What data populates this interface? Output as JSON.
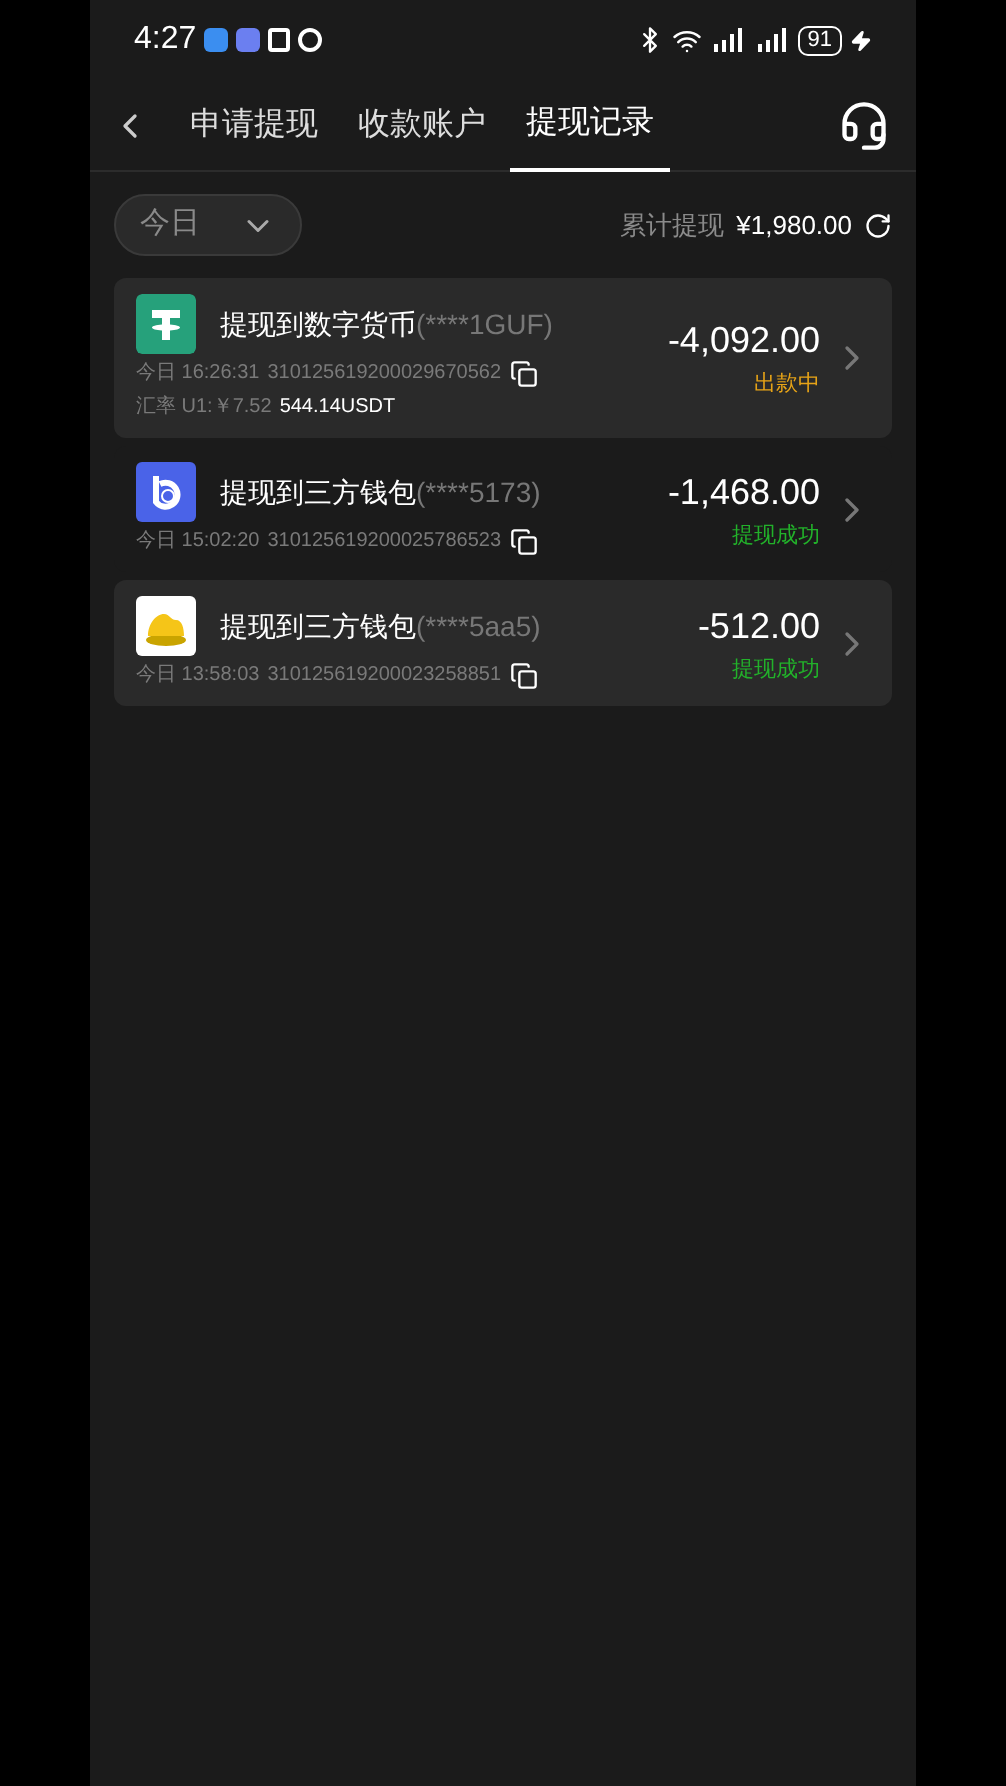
{
  "status_bar": {
    "time": "4:27",
    "battery": "91"
  },
  "tabs": [
    {
      "label": "申请提现",
      "selected": false
    },
    {
      "label": "收款账户",
      "selected": false
    },
    {
      "label": "提现记录",
      "selected": true
    }
  ],
  "filter": {
    "value": "今日"
  },
  "total": {
    "label": "累计提现",
    "amount": "¥1,980.00"
  },
  "records": [
    {
      "kind": "usdt",
      "title": "提现到数字货币",
      "account": "(****1GUF)",
      "time": "今日 16:26:31",
      "order": "310125619200029670562",
      "rate_label": "汇率 U1:￥7.52",
      "rate_value": "544.14USDT",
      "amount": "-4,092.00",
      "status": {
        "text": "出款中",
        "kind": "pending"
      },
      "selected": true
    },
    {
      "kind": "wallet_b",
      "title": "提现到三方钱包",
      "account": "(****5173)",
      "time": "今日 15:02:20",
      "order": "310125619200025786523",
      "amount": "-1,468.00",
      "status": {
        "text": "提现成功",
        "kind": "success"
      },
      "selected": false
    },
    {
      "kind": "wallet_gold",
      "title": "提现到三方钱包",
      "account": "(****5aa5)",
      "time": "今日 13:58:03",
      "order": "310125619200023258851",
      "amount": "-512.00",
      "status": {
        "text": "提现成功",
        "kind": "success"
      },
      "selected": true
    }
  ]
}
